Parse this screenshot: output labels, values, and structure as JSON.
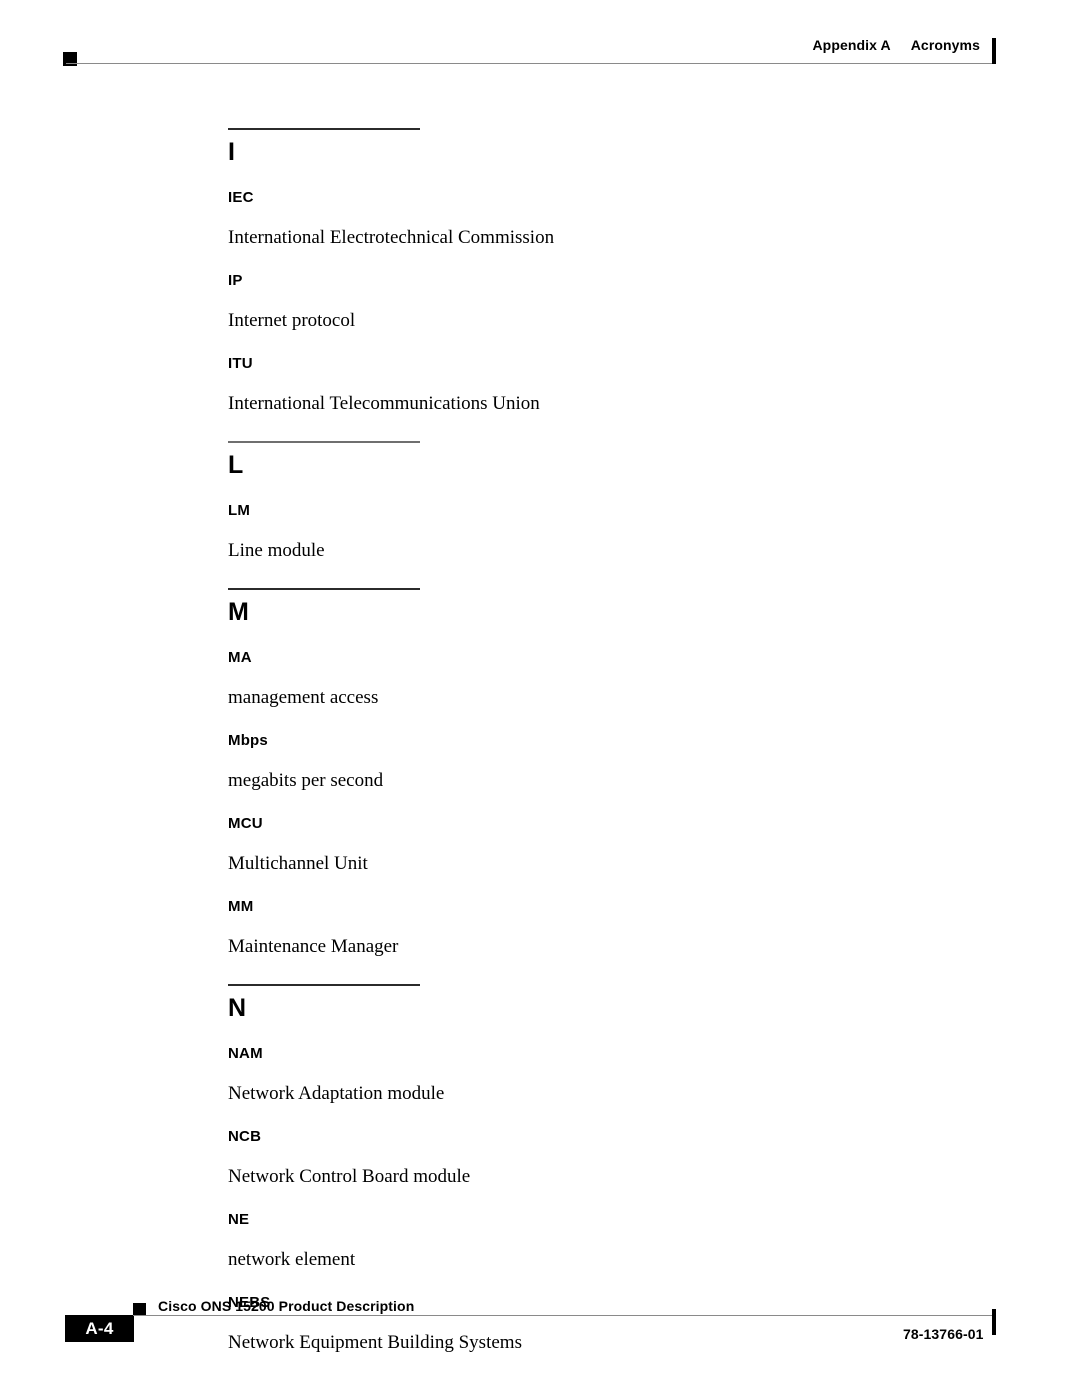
{
  "header": {
    "appendix_label": "Appendix A",
    "section_label": "Acronyms"
  },
  "sections": [
    {
      "letter": "I",
      "entries": [
        {
          "term": "IEC",
          "definition": "International Electrotechnical Commission"
        },
        {
          "term": "IP",
          "definition": "Internet protocol"
        },
        {
          "term": "ITU",
          "definition": "International Telecommunications Union"
        }
      ]
    },
    {
      "letter": "L",
      "entries": [
        {
          "term": "LM",
          "definition": "Line module"
        }
      ]
    },
    {
      "letter": "M",
      "entries": [
        {
          "term": "MA",
          "definition": "management access"
        },
        {
          "term": "Mbps",
          "definition": "megabits per second"
        },
        {
          "term": "MCU",
          "definition": "Multichannel Unit"
        },
        {
          "term": "MM",
          "definition": "Maintenance Manager"
        }
      ]
    },
    {
      "letter": "N",
      "entries": [
        {
          "term": "NAM",
          "definition": "Network Adaptation module"
        },
        {
          "term": "NCB",
          "definition": "Network Control Board module"
        },
        {
          "term": "NE",
          "definition": "network element"
        },
        {
          "term": "NEBS",
          "definition": "Network Equipment Building Systems"
        }
      ]
    }
  ],
  "footer": {
    "page_number": "A-4",
    "document_title": "Cisco ONS 15200 Product Description",
    "document_number": "78-13766-01"
  }
}
